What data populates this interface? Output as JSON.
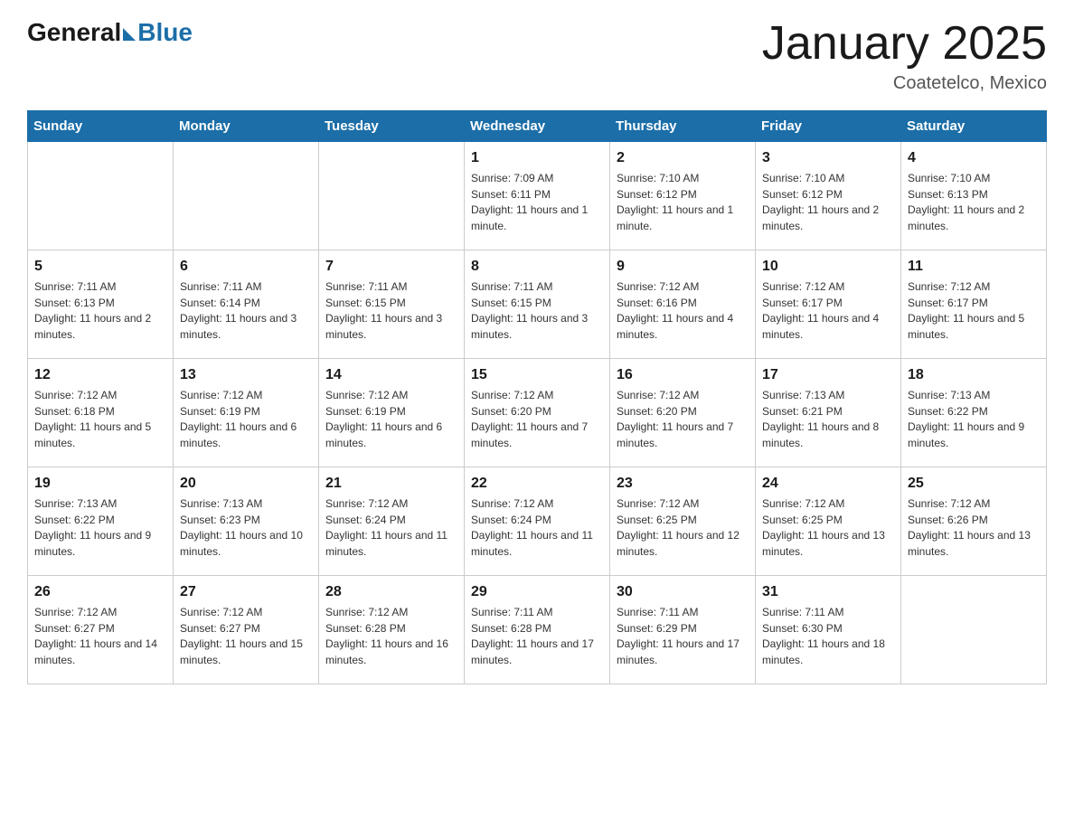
{
  "header": {
    "logo_general": "General",
    "logo_blue": "Blue",
    "title": "January 2025",
    "subtitle": "Coatetelco, Mexico"
  },
  "days_of_week": [
    "Sunday",
    "Monday",
    "Tuesday",
    "Wednesday",
    "Thursday",
    "Friday",
    "Saturday"
  ],
  "weeks": [
    [
      {
        "day": "",
        "info": ""
      },
      {
        "day": "",
        "info": ""
      },
      {
        "day": "",
        "info": ""
      },
      {
        "day": "1",
        "info": "Sunrise: 7:09 AM\nSunset: 6:11 PM\nDaylight: 11 hours and 1 minute."
      },
      {
        "day": "2",
        "info": "Sunrise: 7:10 AM\nSunset: 6:12 PM\nDaylight: 11 hours and 1 minute."
      },
      {
        "day": "3",
        "info": "Sunrise: 7:10 AM\nSunset: 6:12 PM\nDaylight: 11 hours and 2 minutes."
      },
      {
        "day": "4",
        "info": "Sunrise: 7:10 AM\nSunset: 6:13 PM\nDaylight: 11 hours and 2 minutes."
      }
    ],
    [
      {
        "day": "5",
        "info": "Sunrise: 7:11 AM\nSunset: 6:13 PM\nDaylight: 11 hours and 2 minutes."
      },
      {
        "day": "6",
        "info": "Sunrise: 7:11 AM\nSunset: 6:14 PM\nDaylight: 11 hours and 3 minutes."
      },
      {
        "day": "7",
        "info": "Sunrise: 7:11 AM\nSunset: 6:15 PM\nDaylight: 11 hours and 3 minutes."
      },
      {
        "day": "8",
        "info": "Sunrise: 7:11 AM\nSunset: 6:15 PM\nDaylight: 11 hours and 3 minutes."
      },
      {
        "day": "9",
        "info": "Sunrise: 7:12 AM\nSunset: 6:16 PM\nDaylight: 11 hours and 4 minutes."
      },
      {
        "day": "10",
        "info": "Sunrise: 7:12 AM\nSunset: 6:17 PM\nDaylight: 11 hours and 4 minutes."
      },
      {
        "day": "11",
        "info": "Sunrise: 7:12 AM\nSunset: 6:17 PM\nDaylight: 11 hours and 5 minutes."
      }
    ],
    [
      {
        "day": "12",
        "info": "Sunrise: 7:12 AM\nSunset: 6:18 PM\nDaylight: 11 hours and 5 minutes."
      },
      {
        "day": "13",
        "info": "Sunrise: 7:12 AM\nSunset: 6:19 PM\nDaylight: 11 hours and 6 minutes."
      },
      {
        "day": "14",
        "info": "Sunrise: 7:12 AM\nSunset: 6:19 PM\nDaylight: 11 hours and 6 minutes."
      },
      {
        "day": "15",
        "info": "Sunrise: 7:12 AM\nSunset: 6:20 PM\nDaylight: 11 hours and 7 minutes."
      },
      {
        "day": "16",
        "info": "Sunrise: 7:12 AM\nSunset: 6:20 PM\nDaylight: 11 hours and 7 minutes."
      },
      {
        "day": "17",
        "info": "Sunrise: 7:13 AM\nSunset: 6:21 PM\nDaylight: 11 hours and 8 minutes."
      },
      {
        "day": "18",
        "info": "Sunrise: 7:13 AM\nSunset: 6:22 PM\nDaylight: 11 hours and 9 minutes."
      }
    ],
    [
      {
        "day": "19",
        "info": "Sunrise: 7:13 AM\nSunset: 6:22 PM\nDaylight: 11 hours and 9 minutes."
      },
      {
        "day": "20",
        "info": "Sunrise: 7:13 AM\nSunset: 6:23 PM\nDaylight: 11 hours and 10 minutes."
      },
      {
        "day": "21",
        "info": "Sunrise: 7:12 AM\nSunset: 6:24 PM\nDaylight: 11 hours and 11 minutes."
      },
      {
        "day": "22",
        "info": "Sunrise: 7:12 AM\nSunset: 6:24 PM\nDaylight: 11 hours and 11 minutes."
      },
      {
        "day": "23",
        "info": "Sunrise: 7:12 AM\nSunset: 6:25 PM\nDaylight: 11 hours and 12 minutes."
      },
      {
        "day": "24",
        "info": "Sunrise: 7:12 AM\nSunset: 6:25 PM\nDaylight: 11 hours and 13 minutes."
      },
      {
        "day": "25",
        "info": "Sunrise: 7:12 AM\nSunset: 6:26 PM\nDaylight: 11 hours and 13 minutes."
      }
    ],
    [
      {
        "day": "26",
        "info": "Sunrise: 7:12 AM\nSunset: 6:27 PM\nDaylight: 11 hours and 14 minutes."
      },
      {
        "day": "27",
        "info": "Sunrise: 7:12 AM\nSunset: 6:27 PM\nDaylight: 11 hours and 15 minutes."
      },
      {
        "day": "28",
        "info": "Sunrise: 7:12 AM\nSunset: 6:28 PM\nDaylight: 11 hours and 16 minutes."
      },
      {
        "day": "29",
        "info": "Sunrise: 7:11 AM\nSunset: 6:28 PM\nDaylight: 11 hours and 17 minutes."
      },
      {
        "day": "30",
        "info": "Sunrise: 7:11 AM\nSunset: 6:29 PM\nDaylight: 11 hours and 17 minutes."
      },
      {
        "day": "31",
        "info": "Sunrise: 7:11 AM\nSunset: 6:30 PM\nDaylight: 11 hours and 18 minutes."
      },
      {
        "day": "",
        "info": ""
      }
    ]
  ]
}
